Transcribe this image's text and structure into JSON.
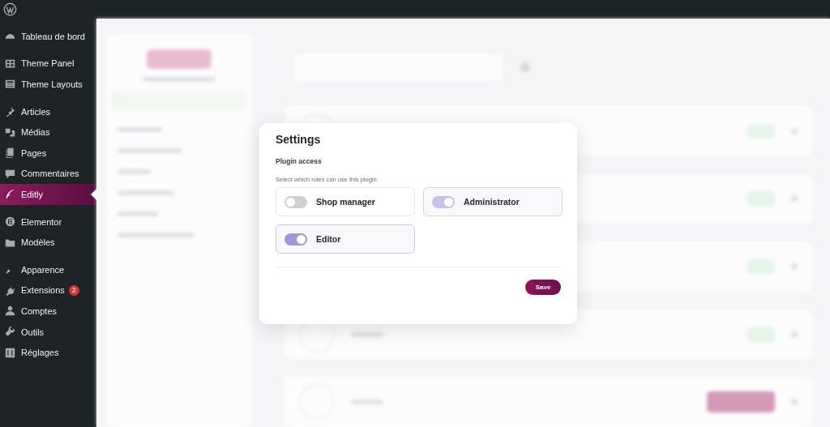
{
  "sidebar": {
    "groups": [
      [
        {
          "label": "Tableau de bord",
          "selected": false
        }
      ],
      [
        {
          "label": "Theme Panel",
          "selected": false
        },
        {
          "label": "Theme Layouts",
          "selected": false
        }
      ],
      [
        {
          "label": "Articles",
          "selected": false
        },
        {
          "label": "Médias",
          "selected": false
        },
        {
          "label": "Pages",
          "selected": false
        },
        {
          "label": "Commentaires",
          "selected": false
        },
        {
          "label": "Editly",
          "selected": true
        }
      ],
      [
        {
          "label": "Elementor",
          "selected": false
        },
        {
          "label": "Modèles",
          "selected": false
        }
      ],
      [
        {
          "label": "Apparence",
          "selected": false
        },
        {
          "label": "Extensions",
          "selected": false,
          "badge": "2"
        },
        {
          "label": "Comptes",
          "selected": false
        },
        {
          "label": "Outils",
          "selected": false
        },
        {
          "label": "Réglages",
          "selected": false
        }
      ]
    ]
  },
  "modal": {
    "title": "Settings",
    "section": "Plugin access",
    "hint": "Select which roles can use this plugin:",
    "roles": [
      {
        "label": "Shop manager",
        "on": false,
        "disabled": false
      },
      {
        "label": "Administrator",
        "on": true,
        "disabled": true
      },
      {
        "label": "Editor",
        "on": true,
        "disabled": false
      }
    ],
    "button": "Save"
  }
}
